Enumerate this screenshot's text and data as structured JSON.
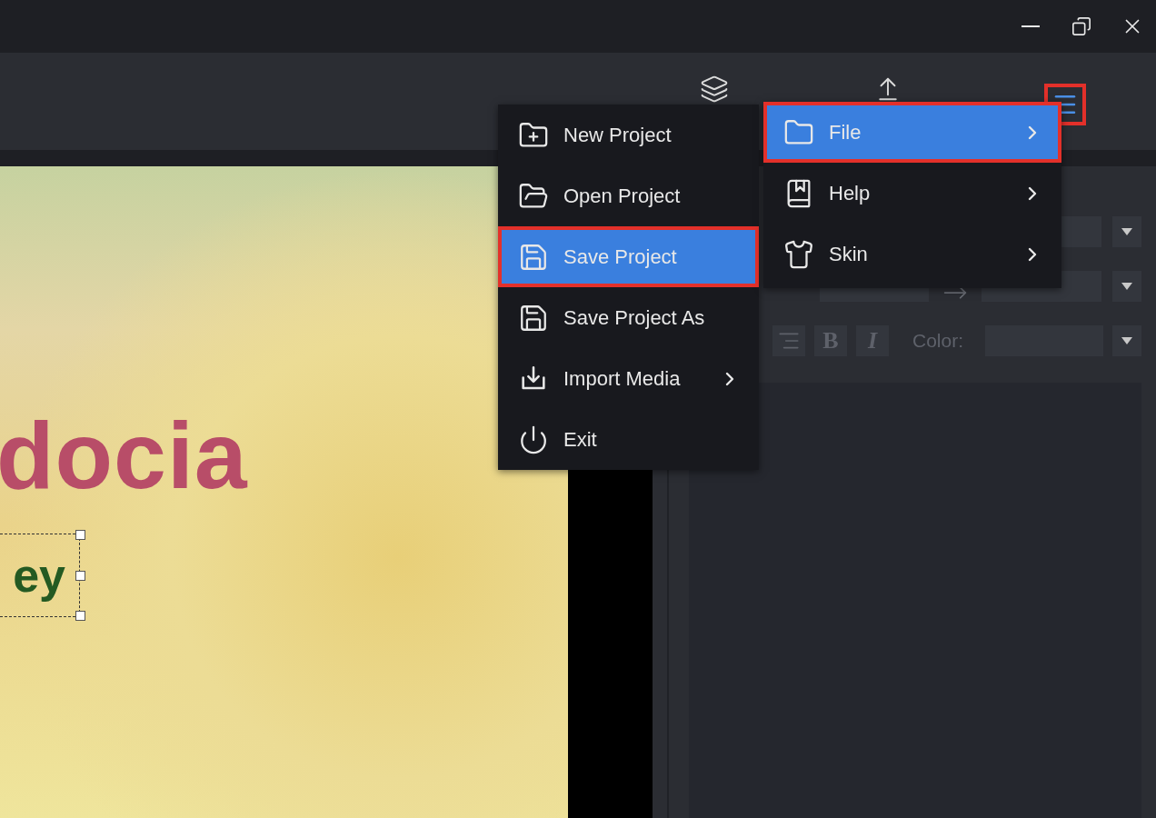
{
  "toolbar": {
    "menu_button": {
      "highlighted": true
    }
  },
  "main_menu": [
    {
      "label": "File",
      "selected": true,
      "highlighted": true,
      "has_submenu": true
    },
    {
      "label": "Help",
      "selected": false,
      "highlighted": false,
      "has_submenu": true
    },
    {
      "label": "Skin",
      "selected": false,
      "highlighted": false,
      "has_submenu": true
    }
  ],
  "file_menu": [
    {
      "label": "New Project",
      "selected": false,
      "highlighted": false,
      "has_submenu": false
    },
    {
      "label": "Open Project",
      "selected": false,
      "highlighted": false,
      "has_submenu": false
    },
    {
      "label": "Save Project",
      "selected": true,
      "highlighted": true,
      "has_submenu": false
    },
    {
      "label": "Save Project As",
      "selected": false,
      "highlighted": false,
      "has_submenu": false
    },
    {
      "label": "Import Media",
      "selected": false,
      "highlighted": false,
      "has_submenu": true
    },
    {
      "label": "Exit",
      "selected": false,
      "highlighted": false,
      "has_submenu": false
    }
  ],
  "canvas": {
    "title_text": "docia",
    "subtitle_text": "ey",
    "subtitle_selected": true
  },
  "properties": {
    "bold_label": "B",
    "italic_label": "I",
    "color_label": "Color:"
  }
}
